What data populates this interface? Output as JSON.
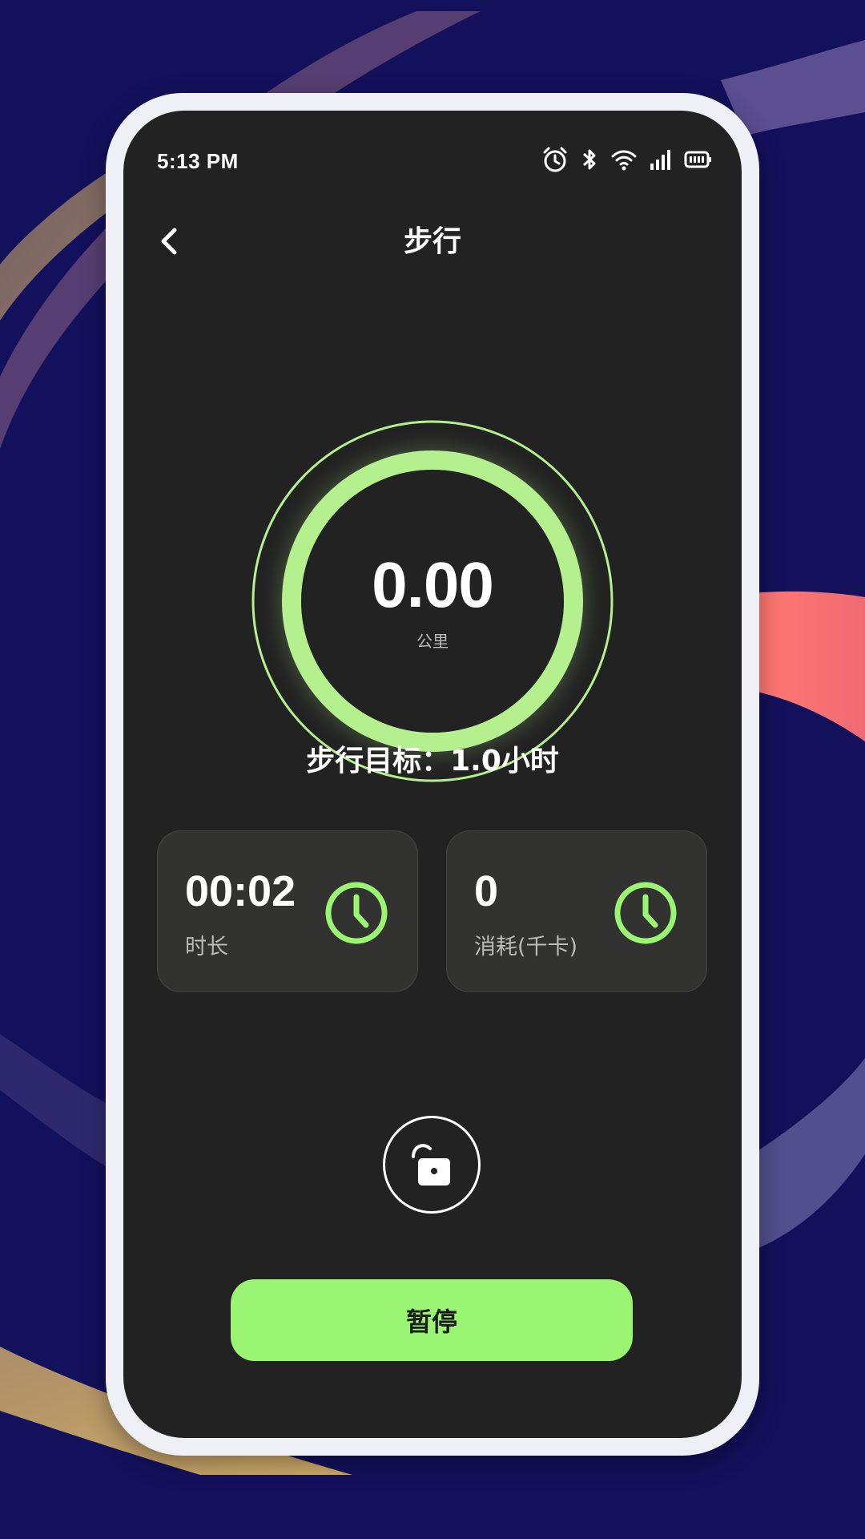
{
  "status_bar": {
    "time": "5:13 PM",
    "icons": [
      "alarm-icon",
      "bluetooth-icon",
      "wifi-icon",
      "signal-icon",
      "battery-icon"
    ]
  },
  "nav": {
    "back_icon": "chevron-left-icon",
    "title": "步行"
  },
  "distance": {
    "value": "0.00",
    "unit": "公里"
  },
  "goal": {
    "text": "步行目标：1.0小时"
  },
  "stats": [
    {
      "value": "00:02",
      "label": "时长",
      "icon": "clock-icon"
    },
    {
      "value": "0",
      "label": "消耗(千卡)",
      "icon": "clock-icon"
    }
  ],
  "lock": {
    "icon": "unlock-icon"
  },
  "pause_button": {
    "label": "暂停"
  },
  "colors": {
    "background": "#13105c",
    "screen": "#222222",
    "accent_green": "#9af573",
    "ring_green": "#b5f08f",
    "card": "#323230"
  }
}
